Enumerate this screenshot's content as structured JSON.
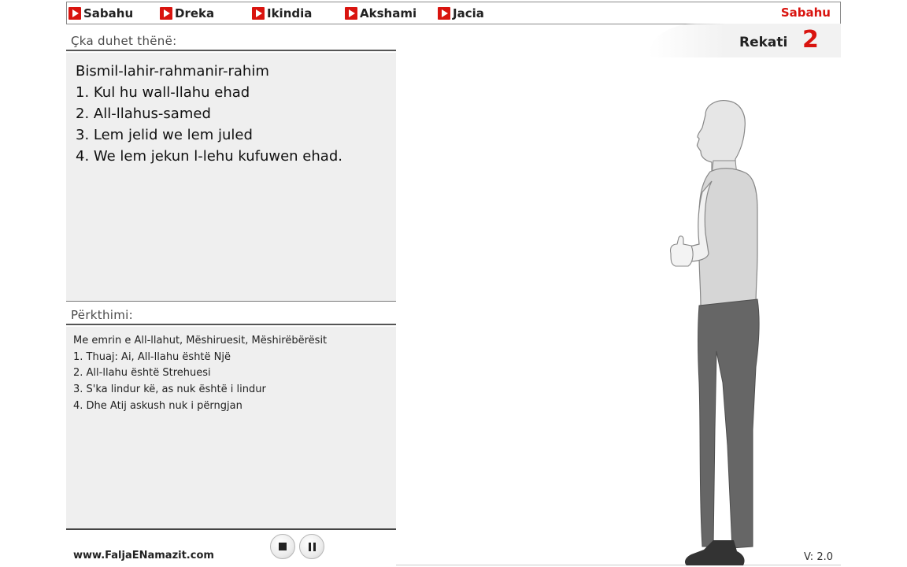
{
  "nav": {
    "items": [
      {
        "label": "Sabahu"
      },
      {
        "label": "Dreka"
      },
      {
        "label": "Ikindia"
      },
      {
        "label": "Akshami"
      },
      {
        "label": "Jacia"
      }
    ],
    "current_prayer": "Sabahu"
  },
  "recite_panel": {
    "header": "Çka duhet thënë:",
    "lines": [
      "Bismil-lahir-rahmanir-rahim",
      "1. Kul hu wall-llahu ehad",
      "2. All-llahus-samed",
      "3. Lem jelid we lem juled",
      "4. We lem jekun l-lehu kufuwen ehad."
    ]
  },
  "translation_panel": {
    "header": "Përkthimi:",
    "lines": [
      "Me emrin e All-llahut, Mëshiruesit, Mëshirëbërësit",
      "1. Thuaj: Ai, All-llahu është Një",
      "2. All-llahu është Strehuesi",
      "3. S'ka lindur kë, as nuk është i lindur",
      "4. Dhe Atij askush nuk i përngjan"
    ]
  },
  "rekati": {
    "label": "Rekati",
    "number": "2"
  },
  "footer": {
    "site": "www.FaljaENamazit.com",
    "version": "V: 2.0"
  },
  "icons": {
    "nav_marker": "play-icon",
    "stop": "stop-icon",
    "pause": "pause-icon"
  },
  "colors": {
    "accent": "#d9140f",
    "panel_bg": "#efefef"
  }
}
